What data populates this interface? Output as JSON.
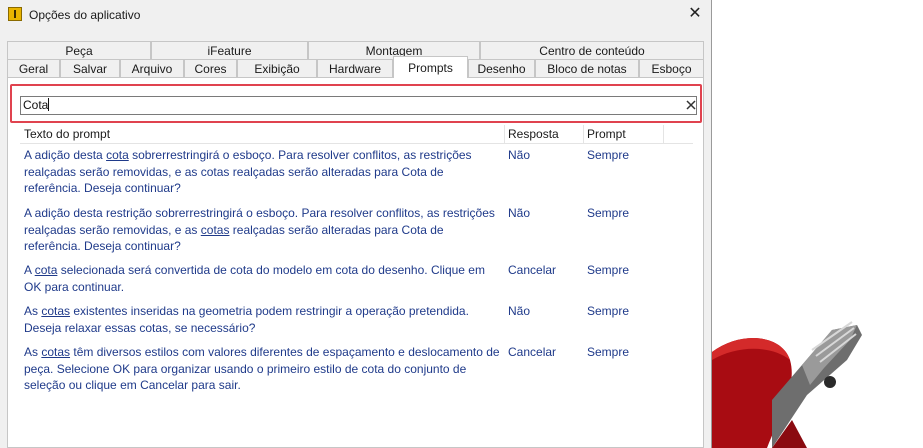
{
  "window": {
    "title": "Opções do aplicativo",
    "close_glyph": "✕"
  },
  "tabs_row1": [
    "Peça",
    "iFeature",
    "Montagem",
    "Centro de conteúdo"
  ],
  "tabs_row2": [
    "Geral",
    "Salvar",
    "Arquivo",
    "Cores",
    "Exibição",
    "Hardware",
    "Prompts",
    "Desenho",
    "Bloco de notas",
    "Esboço"
  ],
  "active_tab": "Prompts",
  "search": {
    "value": "Cota",
    "clear_icon": "close-icon"
  },
  "table": {
    "headers": {
      "text": "Texto do prompt",
      "response": "Resposta",
      "prompt": "Prompt"
    },
    "rows": [
      {
        "pre": "A adição desta ",
        "hl": "cota",
        "post": " sobrerrestringirá o esboço.  Para resolver conflitos, as restrições realçadas serão removidas, e as cotas realçadas serão alteradas para Cota de referência. Deseja continuar?",
        "response": "Não",
        "prompt": "Sempre"
      },
      {
        "pre": "A adição desta restrição sobrerrestringirá o esboço.  Para resolver conflitos, as restrições realçadas serão removidas, e as ",
        "hl": "cotas",
        "post": " realçadas serão alteradas para Cota de referência. Deseja continuar?",
        "response": "Não",
        "prompt": "Sempre"
      },
      {
        "pre": "A ",
        "hl": "cota",
        "post": " selecionada será convertida de cota do modelo em cota do desenho. Clique em OK para continuar.",
        "response": "Cancelar",
        "prompt": "Sempre"
      },
      {
        "pre": "As ",
        "hl": "cotas",
        "post": " existentes inseridas na geometria podem restringir a operação pretendida. Deseja relaxar essas cotas, se necessário?",
        "response": "Não",
        "prompt": "Sempre"
      },
      {
        "pre": "As ",
        "hl": "cotas",
        "post": " têm diversos estilos com valores diferentes de espaçamento e deslocamento de peça. Selecione OK para organizar usando o primeiro estilo de cota do conjunto de seleção ou clique em Cancelar para sair.",
        "response": "Cancelar",
        "prompt": "Sempre"
      }
    ]
  },
  "colors": {
    "highlight_border": "#e0434f",
    "row_text": "#1f3a8a"
  }
}
